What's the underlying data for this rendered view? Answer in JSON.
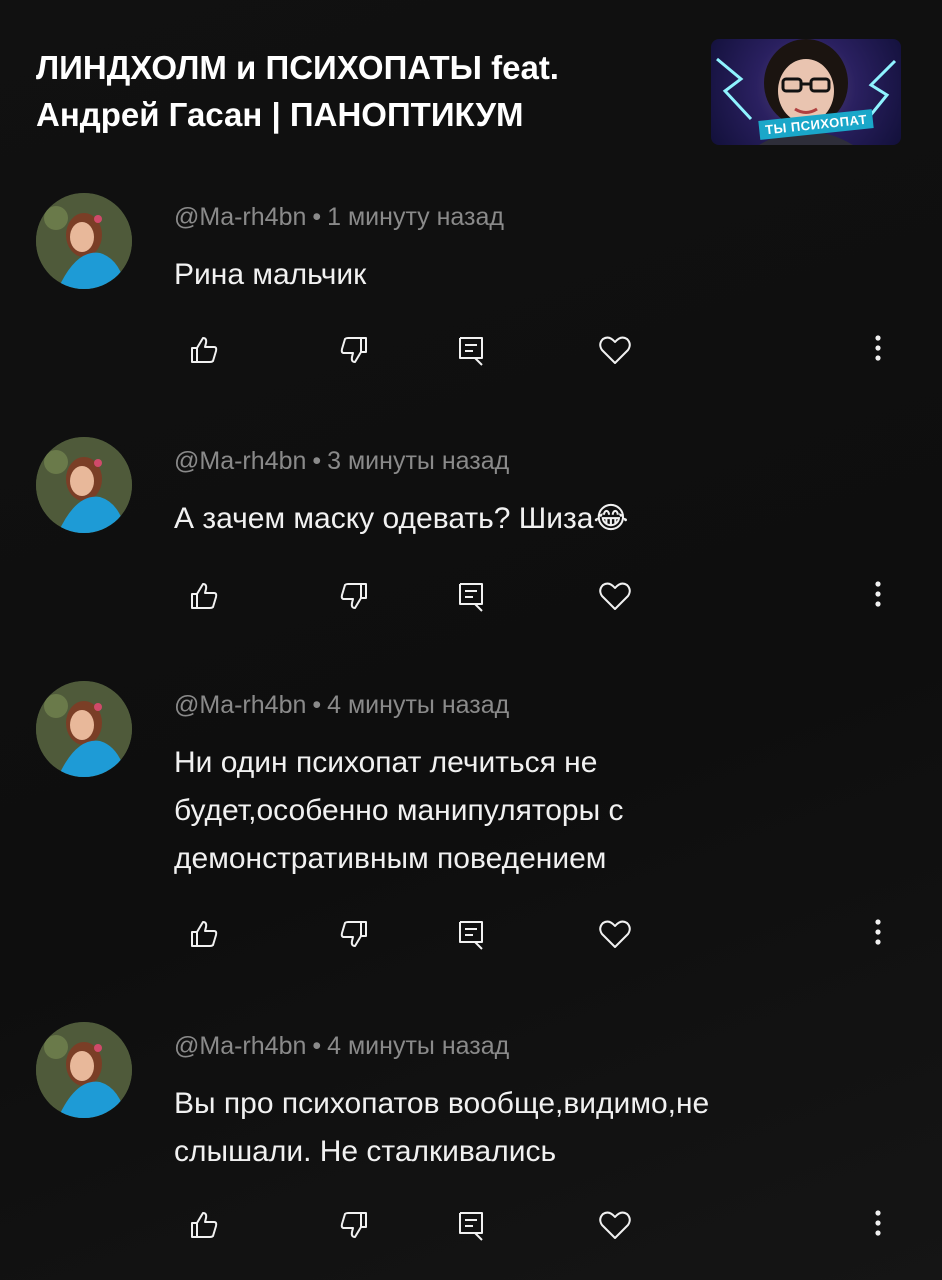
{
  "video": {
    "title_line1": "ЛИНДХОЛМ и ПСИХОПАТЫ feat.",
    "title_line2": "Андрей Гасан | ПАНОПТИКУМ",
    "thumbnail_caption": "ТЫ ПСИХОПАТ"
  },
  "comments": [
    {
      "author": "@Ma-rh4bn",
      "separator": "•",
      "time": "1 минуту назад",
      "text": "Рина мальчик"
    },
    {
      "author": "@Ma-rh4bn",
      "separator": "•",
      "time": "3 минуты назад",
      "text": "А зачем маску одевать? Шиза😂"
    },
    {
      "author": "@Ma-rh4bn",
      "separator": "•",
      "time": "4 минуты назад",
      "text": "Ни один психопат лечиться не будет,особенно манипуляторы с демонстративным поведением"
    },
    {
      "author": "@Ma-rh4bn",
      "separator": "•",
      "time": "4 минуты назад",
      "text": "Вы про психопатов вообще,видимо,не слышали. Не сталкивались"
    }
  ],
  "icons": {
    "like": "thumb-up-icon",
    "dislike": "thumb-down-icon",
    "reply": "reply-icon",
    "heart": "heart-icon",
    "more": "more-vertical-icon"
  }
}
